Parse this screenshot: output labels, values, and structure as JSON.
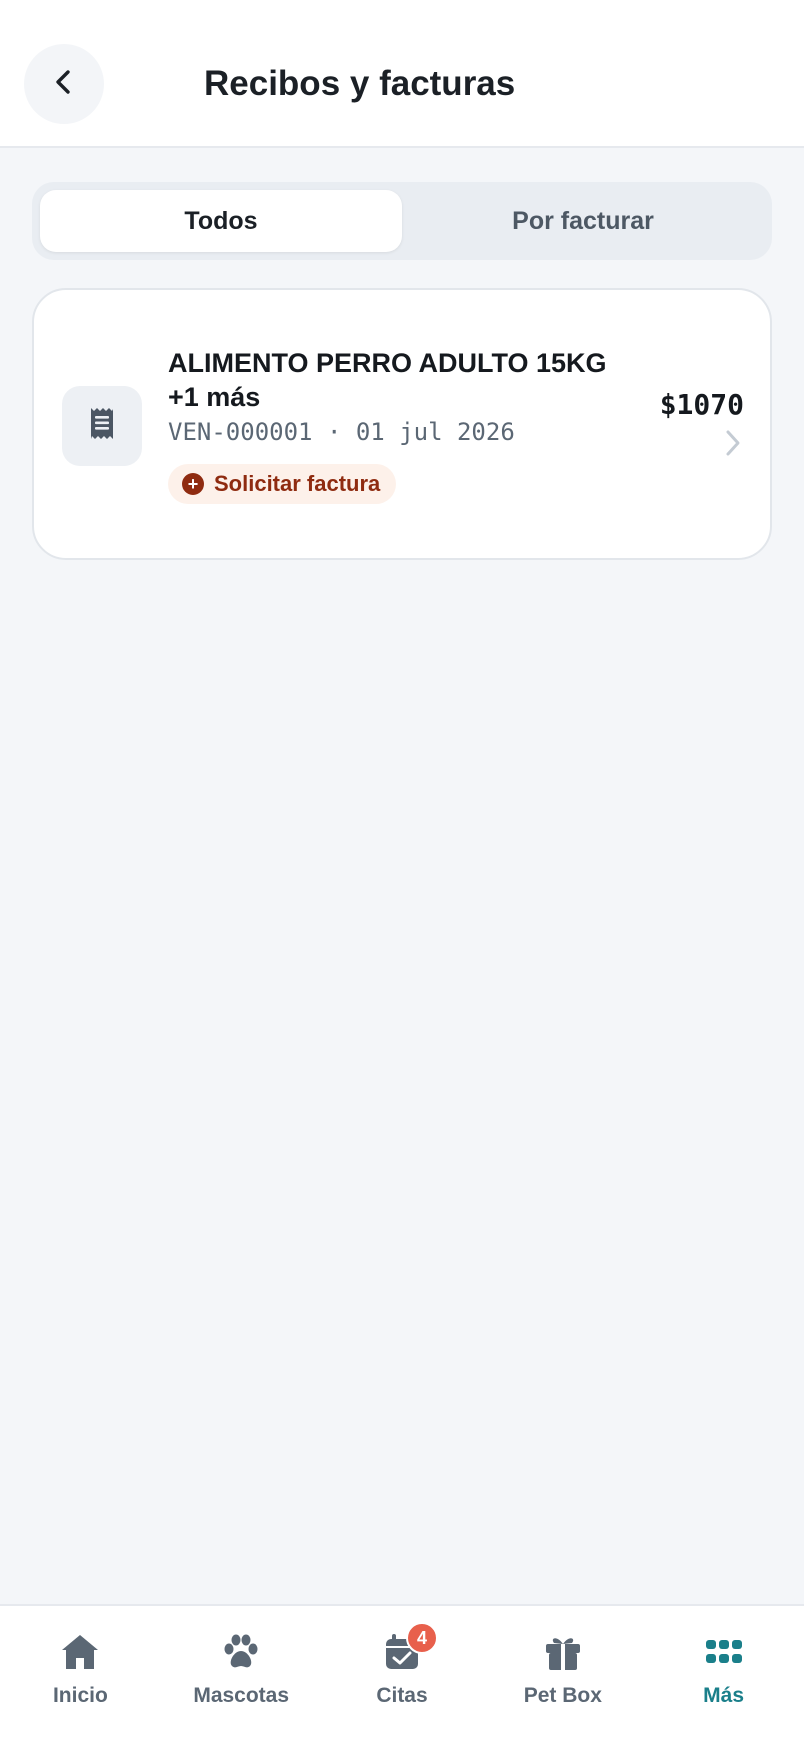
{
  "header": {
    "title": "Recibos y facturas",
    "back_icon": "chevron-left-icon"
  },
  "tabs": [
    {
      "label": "Todos",
      "active": true
    },
    {
      "label": "Por facturar",
      "active": false
    }
  ],
  "receipts": [
    {
      "icon": "receipt-icon",
      "title_line1": "ALIMENTO PERRO ADULTO 15KG",
      "title_line2": "+1 más",
      "meta": "VEN-000001 · 01 jul 2026",
      "amount": "$1070",
      "action_label": "Solicitar factura",
      "action_icon": "plus-circle-icon"
    }
  ],
  "bottom_nav": {
    "items": [
      {
        "label": "Inicio",
        "icon": "home-icon"
      },
      {
        "label": "Mascotas",
        "icon": "paw-icon"
      },
      {
        "label": "Citas",
        "icon": "calendar-check-icon",
        "badge": "4"
      },
      {
        "label": "Pet Box",
        "icon": "gift-icon"
      },
      {
        "label": "Más",
        "icon": "grid-dots-icon",
        "active": true
      }
    ]
  },
  "colors": {
    "accent": "#1a7f8a",
    "badge": "#e8604c",
    "invoice_action": "#8f2b10",
    "invoice_action_bg": "#fdf1ea",
    "background": "#f4f6f9"
  }
}
